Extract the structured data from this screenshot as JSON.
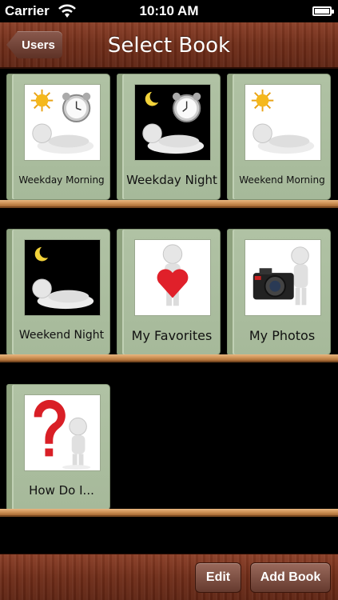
{
  "status_bar": {
    "carrier": "Carrier",
    "time": "10:10 AM"
  },
  "nav": {
    "back_label": "Users",
    "title": "Select Book"
  },
  "books": [
    {
      "label": "Weekday Morning",
      "icon": "sleeping-figure-sun-alarm-clock-icon"
    },
    {
      "label": "Weekday Night",
      "icon": "sleeping-figure-moon-alarm-clock-icon"
    },
    {
      "label": "Weekend Morning",
      "icon": "sleeping-figure-sun-icon"
    },
    {
      "label": "Weekend Night",
      "icon": "sleeping-figure-moon-icon"
    },
    {
      "label": "My Favorites",
      "icon": "figure-holding-heart-icon"
    },
    {
      "label": "My Photos",
      "icon": "figure-with-camera-icon"
    },
    {
      "label": "How Do I...",
      "icon": "figure-question-mark-icon"
    }
  ],
  "toolbar": {
    "edit_label": "Edit",
    "add_book_label": "Add Book"
  },
  "colors": {
    "wood": "#6e2c18",
    "shelf": "#cf9358",
    "book_cover": "#a6b99a",
    "background": "#000000"
  }
}
